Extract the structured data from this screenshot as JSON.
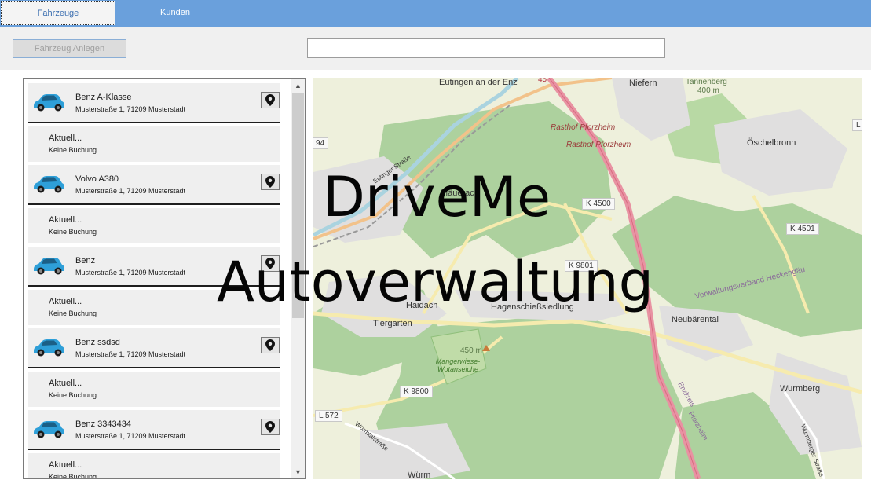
{
  "tabs": [
    {
      "label": "Fahrzeuge",
      "active": true
    },
    {
      "label": "Kunden",
      "active": false
    }
  ],
  "toolbar": {
    "add_button_label": "Fahrzeug Anlegen",
    "search_value": ""
  },
  "vehicles": [
    {
      "name": "Benz A-Klasse",
      "address": "Musterstraße 1, 71209 Musterstadt",
      "status": "Aktuell...",
      "booking": "Keine Buchung"
    },
    {
      "name": "Volvo A380",
      "address": "Musterstraße 1, 71209 Musterstadt",
      "status": "Aktuell...",
      "booking": "Keine Buchung"
    },
    {
      "name": "Benz",
      "address": "Musterstraße 1, 71209 Musterstadt",
      "status": "Aktuell...",
      "booking": "Keine Buchung"
    },
    {
      "name": "Benz ssdsd",
      "address": "Musterstraße 1, 71209 Musterstadt",
      "status": "Aktuell...",
      "booking": "Keine Buchung"
    },
    {
      "name": "Benz 3343434",
      "address": "Musterstraße 1, 71209 Musterstadt",
      "status": "Aktuell...",
      "booking": "Keine Buchung"
    }
  ],
  "icons": {
    "vehicle": "car-icon",
    "locate": "map-pin-icon",
    "scroll_up": "chevron-up-icon",
    "scroll_down": "chevron-down-icon"
  },
  "map": {
    "labels": {
      "eutingen": "Eutingen an der Enz",
      "niefern": "Niefern",
      "tannenberg": "Tannenberg",
      "tannenberg_elev": "400 m",
      "rasthof1": "Rasthof Pforzheim",
      "rasthof2": "Rasthof Pforzheim",
      "oschelbronn": "Öschelbronn",
      "maeurach": "Mäuerach",
      "haidach": "Haidach",
      "tiergarten": "Tiergarten",
      "hagenschiess": "Hagenschießsiedlung",
      "neubaerental": "Neubärental",
      "mangerwiese": "Mangerwiese-Wotanseiche",
      "mangerwiese_elev": "450 m",
      "wurmberg": "Wurmberg",
      "wuerm": "Würm",
      "verwaltungsverband": "Verwaltungsverband Heckengäu",
      "eutinger_strasse": "Eutinger Straße",
      "wurmtalstrasse": "Würmtalstraße",
      "wurmberger_strasse": "Wurmberger Straße",
      "enzkreis": "Enzkreis",
      "pforzheim": "Pforzheim"
    },
    "roads": {
      "k4500": "K 4500",
      "k4501": "K 4501",
      "k9801": "K 9801",
      "k9800": "K 9800",
      "l572": "L 572",
      "r94": "94",
      "r45": "45",
      "rl": "L"
    }
  },
  "overlay": {
    "line1": "DriveMe",
    "line2": "Autoverwaltung"
  },
  "colors": {
    "tabbar": "#6aa0dc",
    "car": "#2e9fd8",
    "motorway": "#e892a2",
    "forest": "#a6d18f"
  }
}
